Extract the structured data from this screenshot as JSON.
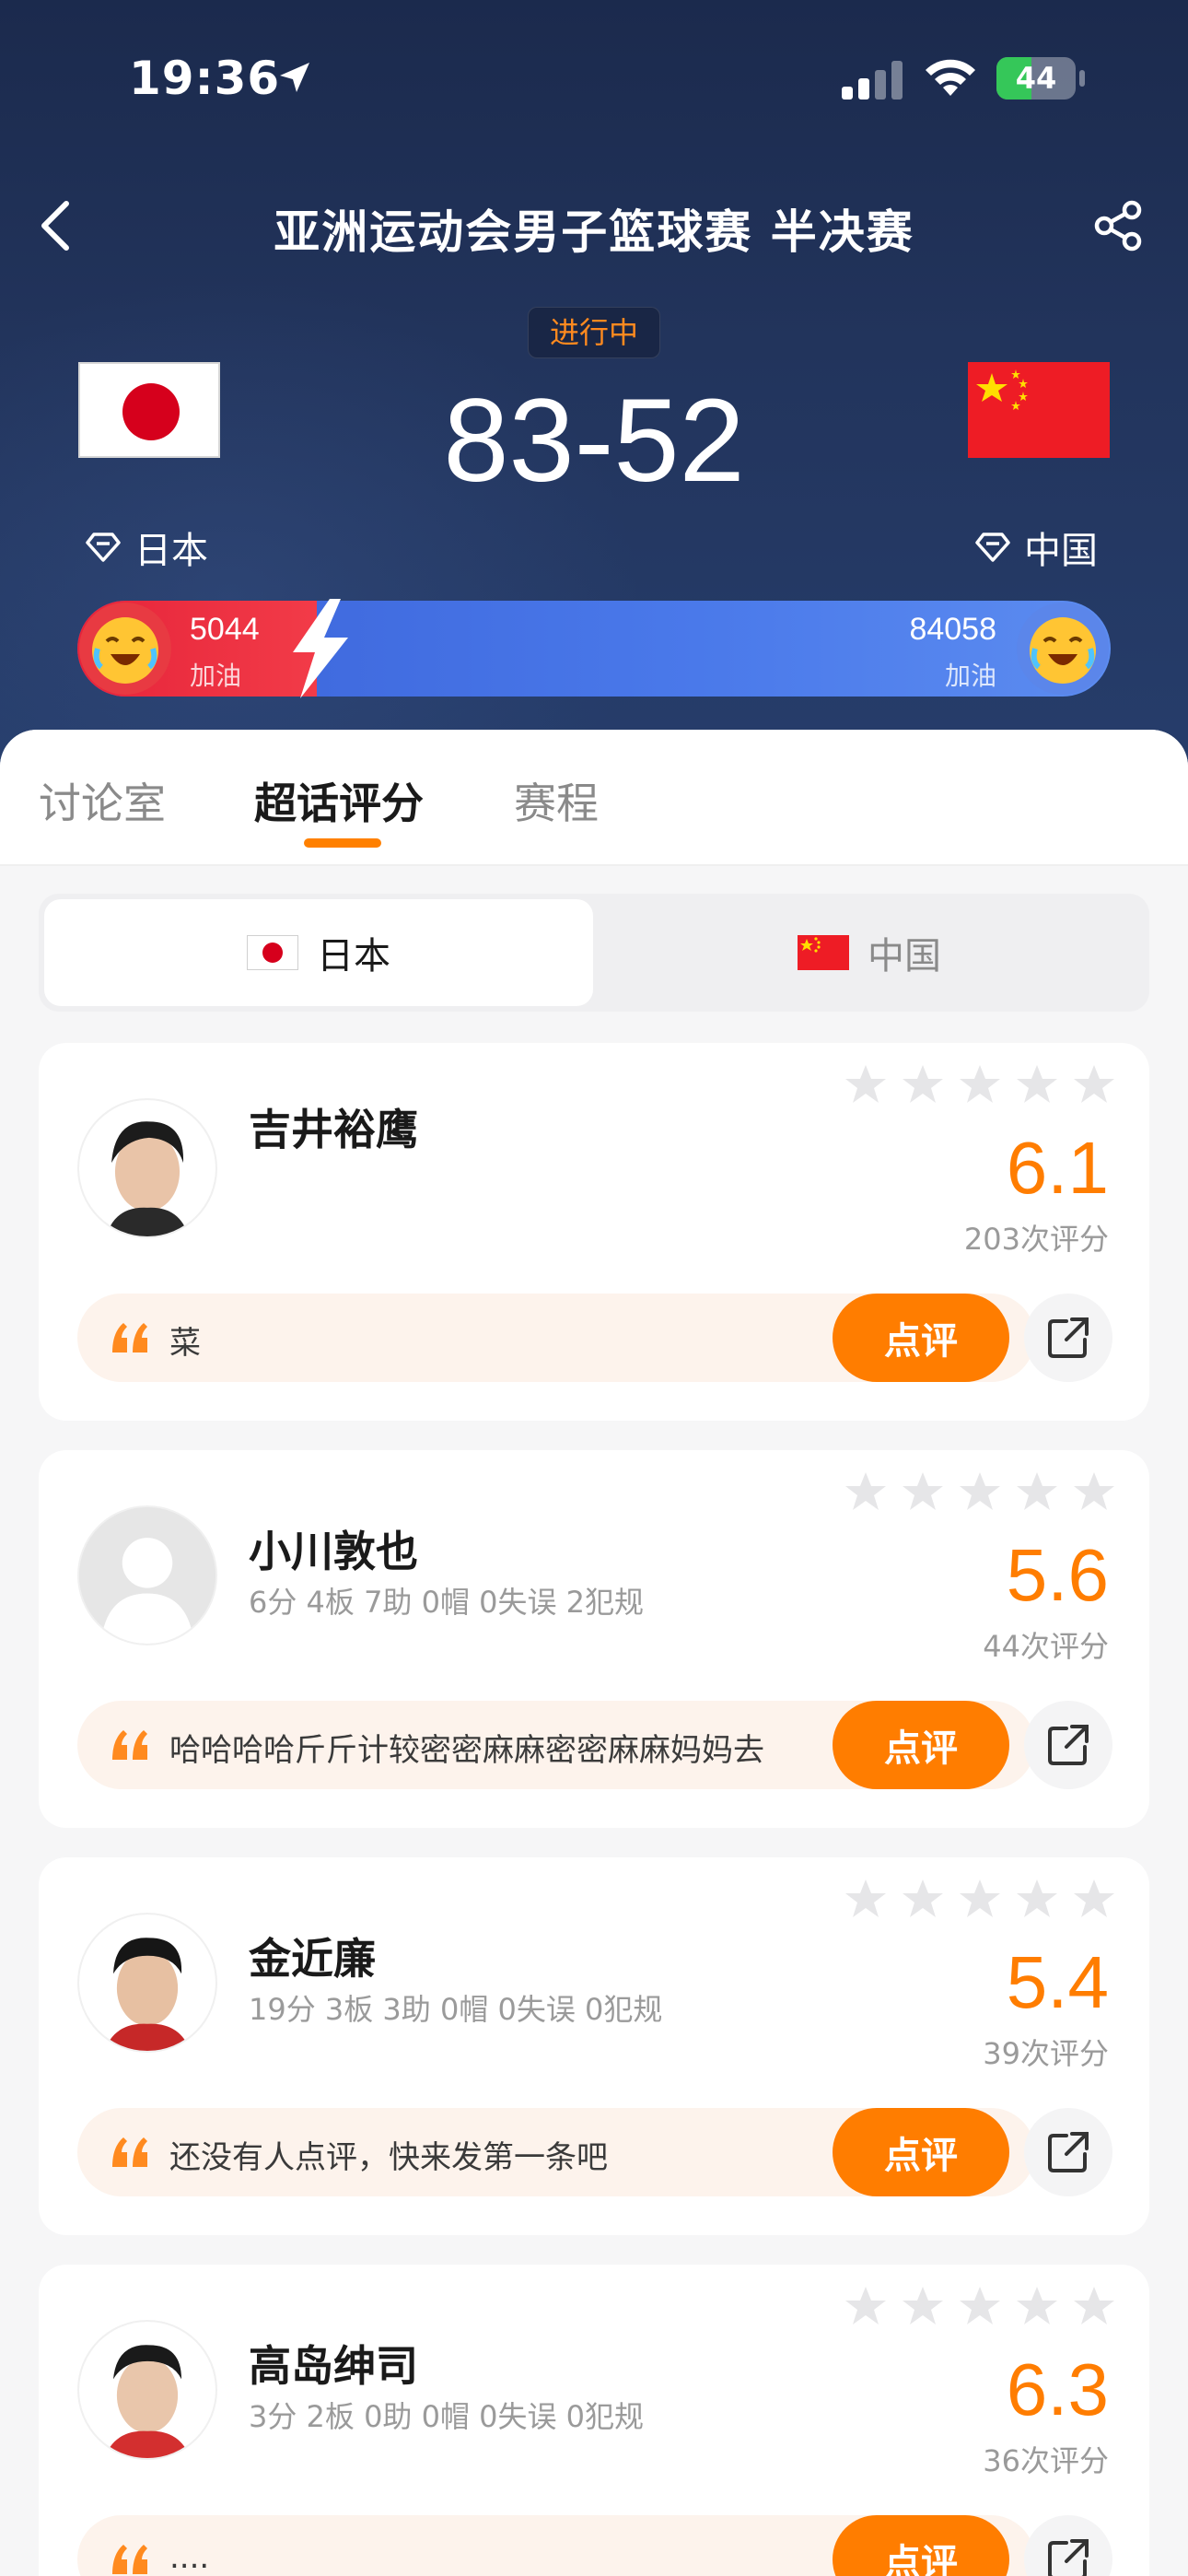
{
  "status": {
    "time": "19:36",
    "battery": "44",
    "battery_level": 0.44
  },
  "header": {
    "title": "亚洲运动会男子篮球赛 半决赛",
    "live_status": "进行中"
  },
  "match": {
    "score": "83-52",
    "team_left": "日本",
    "team_right": "中国",
    "cheer_left": "5044",
    "cheer_right": "84058",
    "cheer_label": "加油",
    "cheer_left_fraction": 0.057
  },
  "tabs": [
    {
      "label": "讨论室"
    },
    {
      "label": "超话评分"
    },
    {
      "label": "赛程"
    }
  ],
  "team_toggle": {
    "active": "日本",
    "inactive": "中国"
  },
  "players": [
    {
      "name": "吉井裕鹰",
      "stats": "",
      "rating": "6.1",
      "count": "203次评分",
      "comment": "菜",
      "button": "点评"
    },
    {
      "name": "小川敦也",
      "stats": "6分 4板 7助 0帽 0失误 2犯规",
      "rating": "5.6",
      "count": "44次评分",
      "comment": "哈哈哈哈斤斤计较密密麻麻密密麻麻妈妈去",
      "button": "点评"
    },
    {
      "name": "金近廉",
      "stats": "19分 3板 3助 0帽 0失误 0犯规",
      "rating": "5.4",
      "count": "39次评分",
      "comment": "还没有人点评，快来发第一条吧",
      "button": "点评"
    },
    {
      "name": "高岛绅司",
      "stats": "3分 2板 0助 0帽 0失误 0犯规",
      "rating": "6.3",
      "count": "36次评分",
      "comment": "....",
      "button": "点评"
    }
  ],
  "colors": {
    "accent": "#ff7d00",
    "header_bg": "#1f3056",
    "cheer_red": "#e6243a",
    "cheer_blue": "#4a79ea"
  }
}
